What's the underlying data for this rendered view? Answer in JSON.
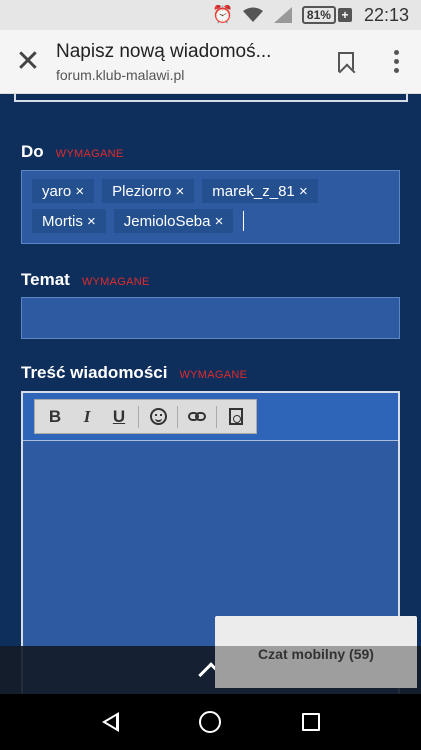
{
  "status_bar": {
    "battery": "81%",
    "time": "22:13",
    "icons": [
      "alarm-icon",
      "wifi-icon",
      "signal-icon",
      "battery-icon"
    ]
  },
  "header": {
    "close_icon": "close-icon",
    "title": "Napisz nową wiadomoś...",
    "url": "forum.klub-malawi.pl",
    "bookmark_icon": "bookmark-icon",
    "menu_icon": "more-vertical-icon"
  },
  "form": {
    "to": {
      "label": "Do",
      "required": "WYMAGANE",
      "recipients": [
        "yaro ×",
        "Pleziorro ×",
        "marek_z_81 ×",
        "Mortis ×",
        "JemioloSeba ×"
      ]
    },
    "subject": {
      "label": "Temat",
      "required": "WYMAGANE",
      "value": ""
    },
    "message": {
      "label": "Treść wiadomości",
      "required": "WYMAGANE",
      "toolbar": {
        "bold": "B",
        "italic": "I",
        "underline": "U",
        "emoji_icon": "smiley-icon",
        "link_icon": "link-icon",
        "preview_icon": "preview-icon"
      },
      "value": ""
    }
  },
  "chat_widget": {
    "label": "Czat mobilny (59)"
  },
  "scroll_top_icon": "chevron-up-icon",
  "nav_bar": {
    "icons": [
      "back-icon",
      "home-icon",
      "recents-icon"
    ]
  },
  "colors": {
    "page_bg": "#0e2e5c",
    "field_bg": "#2d5aa0",
    "required": "#e02b2b"
  }
}
